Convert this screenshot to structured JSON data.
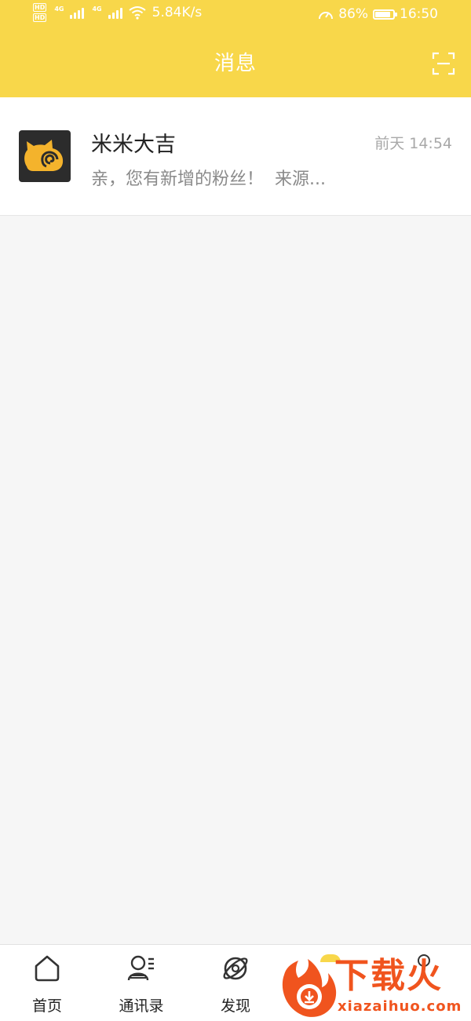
{
  "status_bar": {
    "hd_1": "HD",
    "hd_2": "HD",
    "network_type": "4G",
    "network_speed": "5.84K/s",
    "battery_percent": "86%",
    "battery_level": 0.86,
    "time": "16:50"
  },
  "header": {
    "title": "消息",
    "scan_icon": "scan-icon",
    "background_color": "#f8d74a"
  },
  "messages": [
    {
      "name": "米米大吉",
      "time": "前天 14:54",
      "preview": "亲，您有新增的粉丝！  来源...",
      "avatar_icon": "cat-logo-icon"
    }
  ],
  "tabs": [
    {
      "label": "首页",
      "icon": "home-icon"
    },
    {
      "label": "通讯录",
      "icon": "contacts-icon"
    },
    {
      "label": "发现",
      "icon": "discover-icon"
    }
  ],
  "watermark": {
    "text": "下载火",
    "url_text": "xiazaihuo.com"
  }
}
